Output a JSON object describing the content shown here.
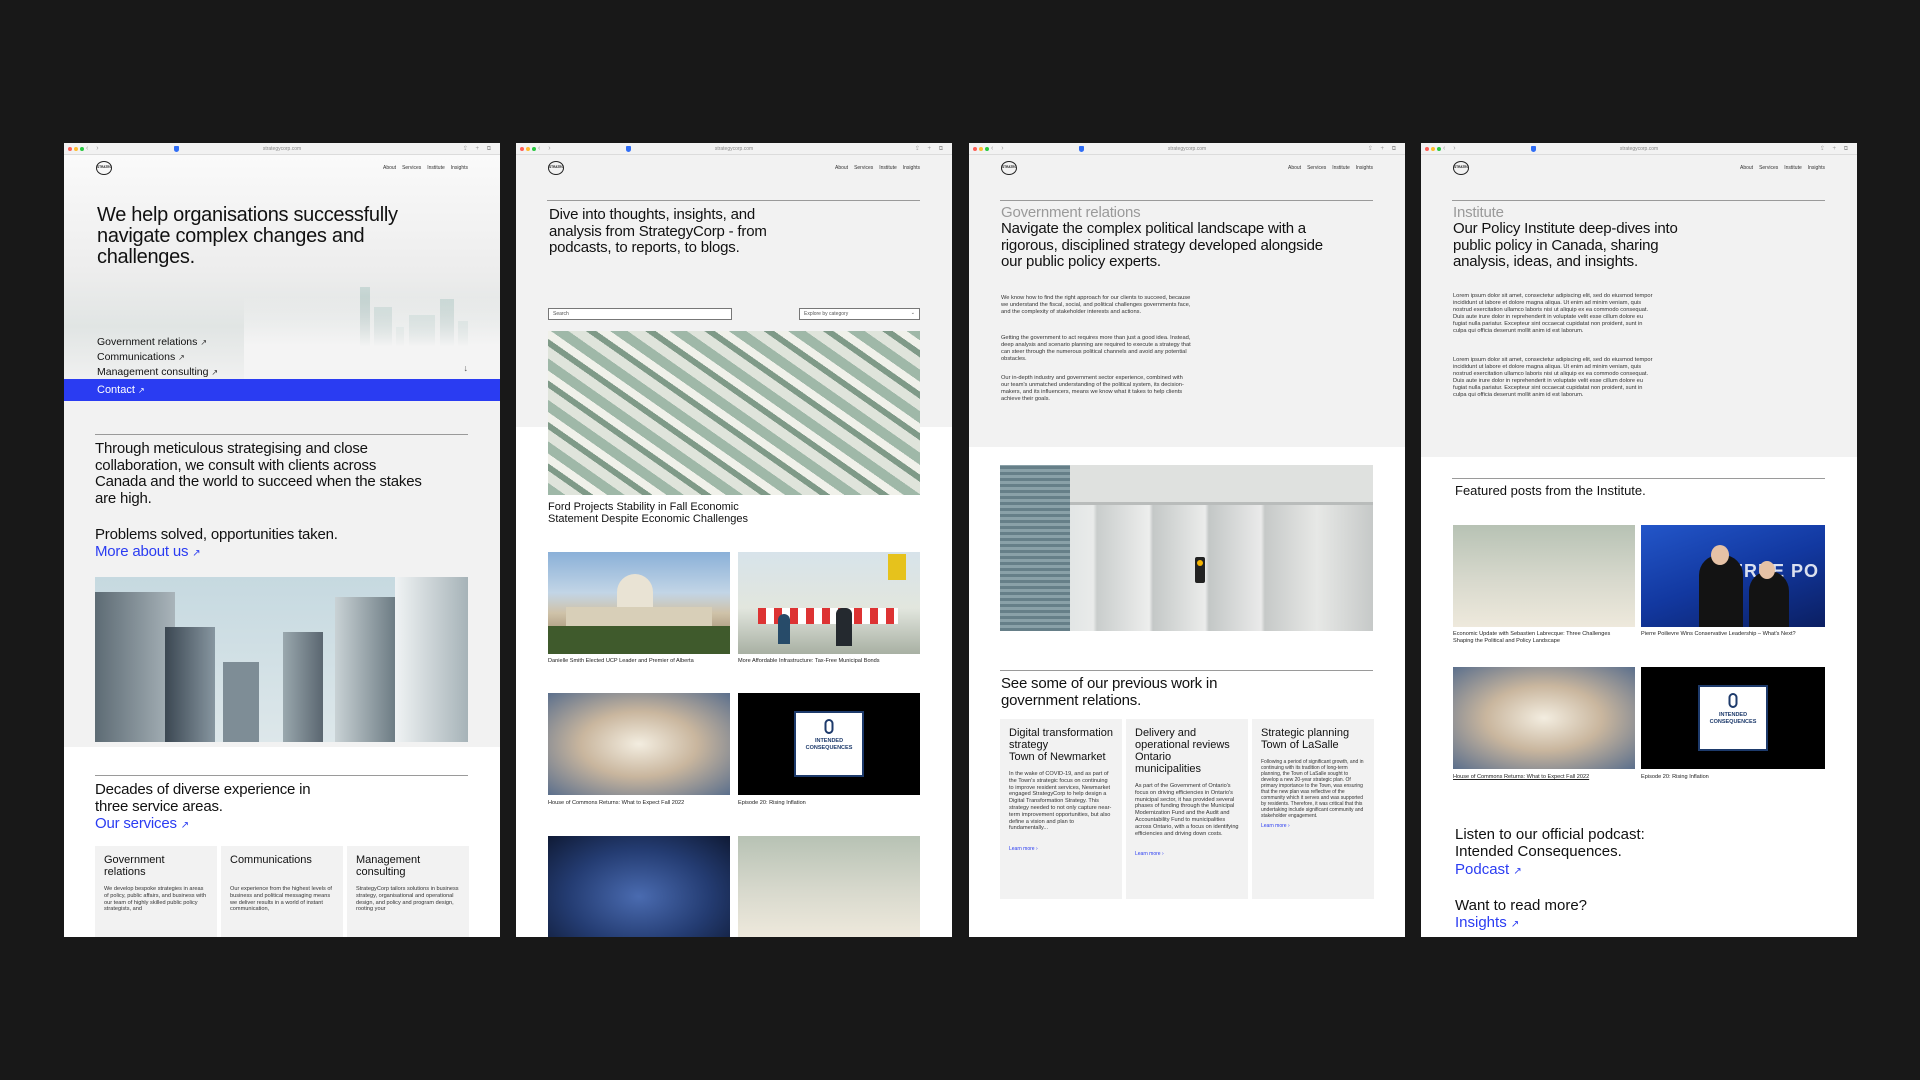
{
  "screens": [
    {
      "url": "strategycorp.com",
      "logo": "STRATEGYCORP",
      "nav": [
        "About",
        "Services",
        "Institute",
        "Insights"
      ],
      "hero_title": "We help organisations successfully navigate complex changes and challenges.",
      "services": [
        "Government relations",
        "Communications",
        "Management consulting"
      ],
      "contact": "Contact",
      "intro": "Through meticulous strategising and close collaboration, we consult with clients across Canada and the world to succeed when the stakes are high.",
      "tagline": "Problems solved, opportunities taken.",
      "about_link": "More about us",
      "experience": "Decades of diverse experience in three service areas.",
      "services_link": "Our services",
      "cards": [
        {
          "title": "Government relations",
          "body": "We develop bespoke strategies in areas of policy, public affairs, and business with our team of highly skilled public policy strategists, and"
        },
        {
          "title": "Communications",
          "body": "Our experience from the highest levels of business and political messaging means we deliver results in a world of instant communication,"
        },
        {
          "title": "Management consulting",
          "body": "StrategyCorp tailors solutions in business strategy, organisational and operational design, and policy and program design, rooting your"
        }
      ]
    },
    {
      "url": "strategycorp.com",
      "logo": "STRATEGYCORP",
      "nav": [
        "About",
        "Services",
        "Institute",
        "Insights"
      ],
      "headline": "Dive into thoughts, insights, and analysis from StrategyCorp - from podcasts, to reports, to blogs.",
      "search_placeholder": "Search",
      "category_label": "Explore by category",
      "feature_caption": "Ford Projects Stability in Fall Economic Statement Despite Economic Challenges",
      "posts": [
        "Danielle Smith Elected UCP Leader and Premier of Alberta",
        "More Affordable Infrastructure: Tax-Free Municipal Bonds",
        "House of Commons Returns: What to Expect Fall 2022",
        "Episode 20: Rising Inflation"
      ],
      "podcast_badge": "INTENDED CONSEQUENCES"
    },
    {
      "url": "strategycorp.com",
      "logo": "STRATEGYCORP",
      "nav": [
        "About",
        "Services",
        "Institute",
        "Insights"
      ],
      "eyebrow": "Government relations",
      "headline": "Navigate the complex political landscape with a rigorous, disciplined strategy developed alongside our public policy experts.",
      "paragraphs": [
        "We know how to find the right approach for our clients to succeed, because we understand the fiscal, social, and political challenges governments face, and the complexity of stakeholder interests and actions.",
        "Getting the government to act requires more than just a good idea. Instead, deep analysis and scenario planning are required to execute a strategy that can steer through the numerous political channels and avoid any potential obstacles.",
        "Our in-depth industry and government sector experience, combined with our team's unmatched understanding of the political system, its decision-makers, and its influencers, means we know what it takes to help clients achieve their goals."
      ],
      "work_heading": "See some of our previous work in government relations.",
      "cases": [
        {
          "title": "Digital transformation strategy",
          "client": "Town of Newmarket",
          "body": "In the wake of COVID-19, and as part of the Town's strategic focus on continuing to improve resident services, Newmarket engaged StrategyCorp to help design a Digital Transformation Strategy. This strategy needed to not only capture near-term improvement opportunities, but also define a vision and plan to fundamentally...",
          "link": "Learn more"
        },
        {
          "title": "Delivery and operational reviews",
          "client": "Ontario municipalities",
          "body": "As part of the Government of Ontario's focus on driving efficiencies in Ontario's municipal sector, it has provided several phases of funding through the Municipal Modernization Fund and the Audit and Accountability Fund to municipalities across Ontario, with a focus on identifying efficiencies and driving down costs.",
          "link": "Learn more"
        },
        {
          "title": "Strategic planning",
          "client": "Town of LaSalle",
          "body": "Following a period of significant growth, and in continuing with its tradition of long-term planning, the Town of LaSalle sought to develop a new 20-year strategic plan. Of primary importance to the Town, was ensuring that the new plan was reflective of the community which it serves and was supported by residents. Therefore, it was critical that this undertaking include significant community and stakeholder engagement.",
          "link": "Learn more"
        }
      ]
    },
    {
      "url": "strategycorp.com",
      "logo": "STRATEGYCORP",
      "nav": [
        "About",
        "Services",
        "Institute",
        "Insights"
      ],
      "eyebrow": "Institute",
      "headline": "Our Policy Institute deep-dives into public policy in Canada, sharing analysis, ideas, and insights.",
      "lorem": [
        "Lorem ipsum dolor sit amet, consectetur adipiscing elit, sed do eiusmod tempor incididunt ut labore et dolore magna aliqua. Ut enim ad minim veniam, quis nostrud exercitation ullamco laboris nisi ut aliquip ex ea commodo consequat. Duis aute irure dolor in reprehenderit in voluptate velit esse cillum dolore eu fugiat nulla pariatur. Excepteur sint occaecat cupidatat non proident, sunt in culpa qui officia deserunt mollit anim id est laborum.",
        "Lorem ipsum dolor sit amet, consectetur adipiscing elit, sed do eiusmod tempor incididunt ut labore et dolore magna aliqua. Ut enim ad minim veniam, quis nostrud exercitation ullamco laboris nisi ut aliquip ex ea commodo consequat. Duis aute irure dolor in reprehenderit in voluptate velit esse cillum dolore eu fugiat nulla pariatur. Excepteur sint occaecat cupidatat non proident, sunt in culpa qui officia deserunt mollit anim id est laborum."
      ],
      "featured_heading": "Featured posts from the Institute.",
      "posts": [
        "Economic Update with Sebastien Labrecque: Three Challenges Shaping the Political and Policy Landscape",
        "Pierre Poilievre Wins Conservative Leadership – What's Next?",
        "House of Commons Returns: What to Expect Fall 2022",
        "Episode 20: Rising Inflation"
      ],
      "crowd_sign": "ERRE PO",
      "podcast_badge": "INTENDED CONSEQUENCES",
      "podcast_heading": "Listen to our official podcast: Intended Consequences.",
      "podcast_link": "Podcast",
      "more_heading": "Want to read more?",
      "insights_link": "Insights"
    }
  ],
  "colors": {
    "accent": "#2a3cf2",
    "panel": "#f2f2f2",
    "backdrop": "#181818"
  },
  "icons": {
    "external_arrow": "↗",
    "down_arrow": "↓"
  }
}
